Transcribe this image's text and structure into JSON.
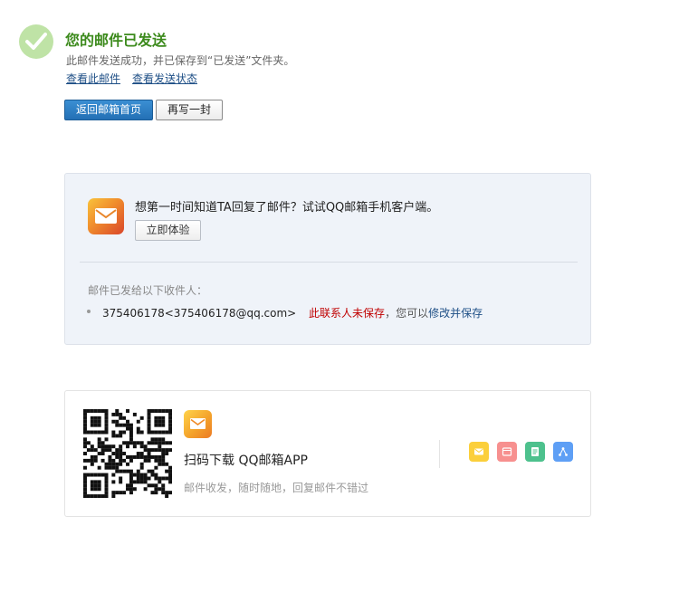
{
  "status": {
    "title": "您的邮件已发送",
    "subtitle": "此邮件发送成功，并已保存到“已发送”文件夹。",
    "link_view_mail": "查看此邮件",
    "link_view_status": "查看发送状态"
  },
  "actions": {
    "back_inbox": "返回邮箱首页",
    "write_another": "再写一封"
  },
  "promo": {
    "icon": "qq-mail-app-icon",
    "text": "想第一时间知道TA回复了邮件？试试QQ邮箱手机客户端。",
    "try_button": "立即体验"
  },
  "recipients": {
    "label": "邮件已发给以下收件人：",
    "items": [
      {
        "address": "375406178<375406178@qq.com>",
        "warning": "此联系人未保存",
        "hint_prefix": "，您可以",
        "hint_link": "修改并保存"
      }
    ]
  },
  "download": {
    "title": "扫码下载 QQ邮箱APP",
    "subtitle": "邮件收发，随时随地，回复邮件不错过",
    "icons": [
      "mail-icon",
      "calendar-icon",
      "note-icon",
      "share-icon"
    ]
  },
  "colors": {
    "success": "#3c8a1c",
    "link": "#1e4f86",
    "primary_button": "#2370b5",
    "warning": "#c00000"
  }
}
